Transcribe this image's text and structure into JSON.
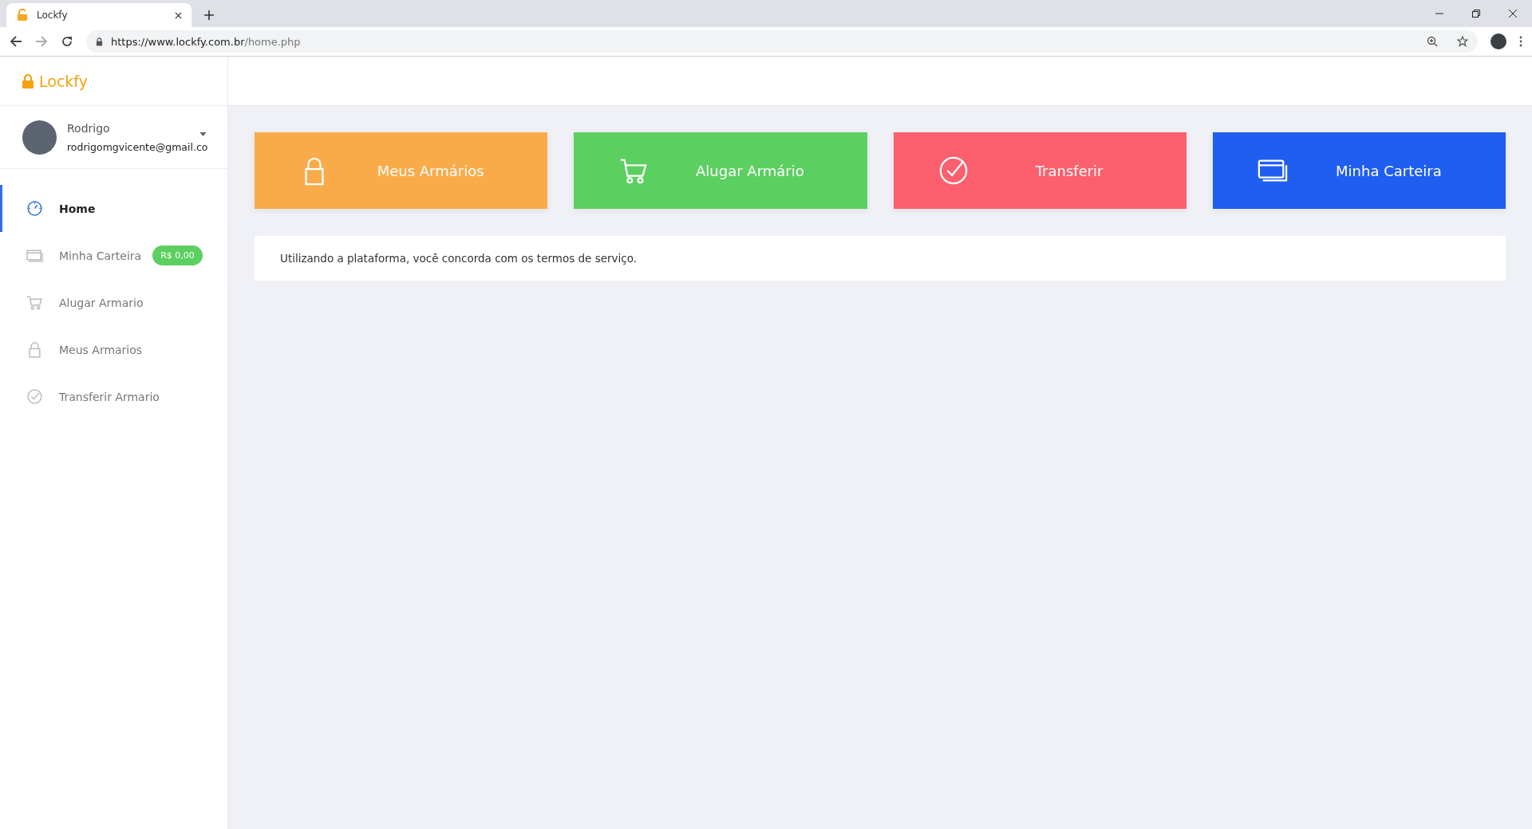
{
  "browser": {
    "tab": {
      "title": "Lockfy"
    },
    "url": {
      "host": "https://www.lockfy.com.br",
      "path": "/home.php"
    }
  },
  "brand": {
    "name": "Lockfy"
  },
  "user": {
    "name": "Rodrigo",
    "email": "rodrigomgvicente@gmail.co"
  },
  "sidebar": {
    "items": [
      {
        "label": "Home",
        "selected": true
      },
      {
        "label": "Minha Carteira",
        "selected": false,
        "badge": "R$ 0,00"
      },
      {
        "label": "Alugar Armario",
        "selected": false
      },
      {
        "label": "Meus Armarios",
        "selected": false
      },
      {
        "label": "Transferir Armario",
        "selected": false
      }
    ]
  },
  "cards": [
    {
      "label": "Meus Armários",
      "color": "#f9ab4a"
    },
    {
      "label": "Alugar Armário",
      "color": "#5bcf5f"
    },
    {
      "label": "Transferir",
      "color": "#fc5f6d"
    },
    {
      "label": "Minha Carteira",
      "color": "#1f5ef0"
    }
  ],
  "notice": "Utilizando a plataforma, você concorda com os termos de serviço."
}
